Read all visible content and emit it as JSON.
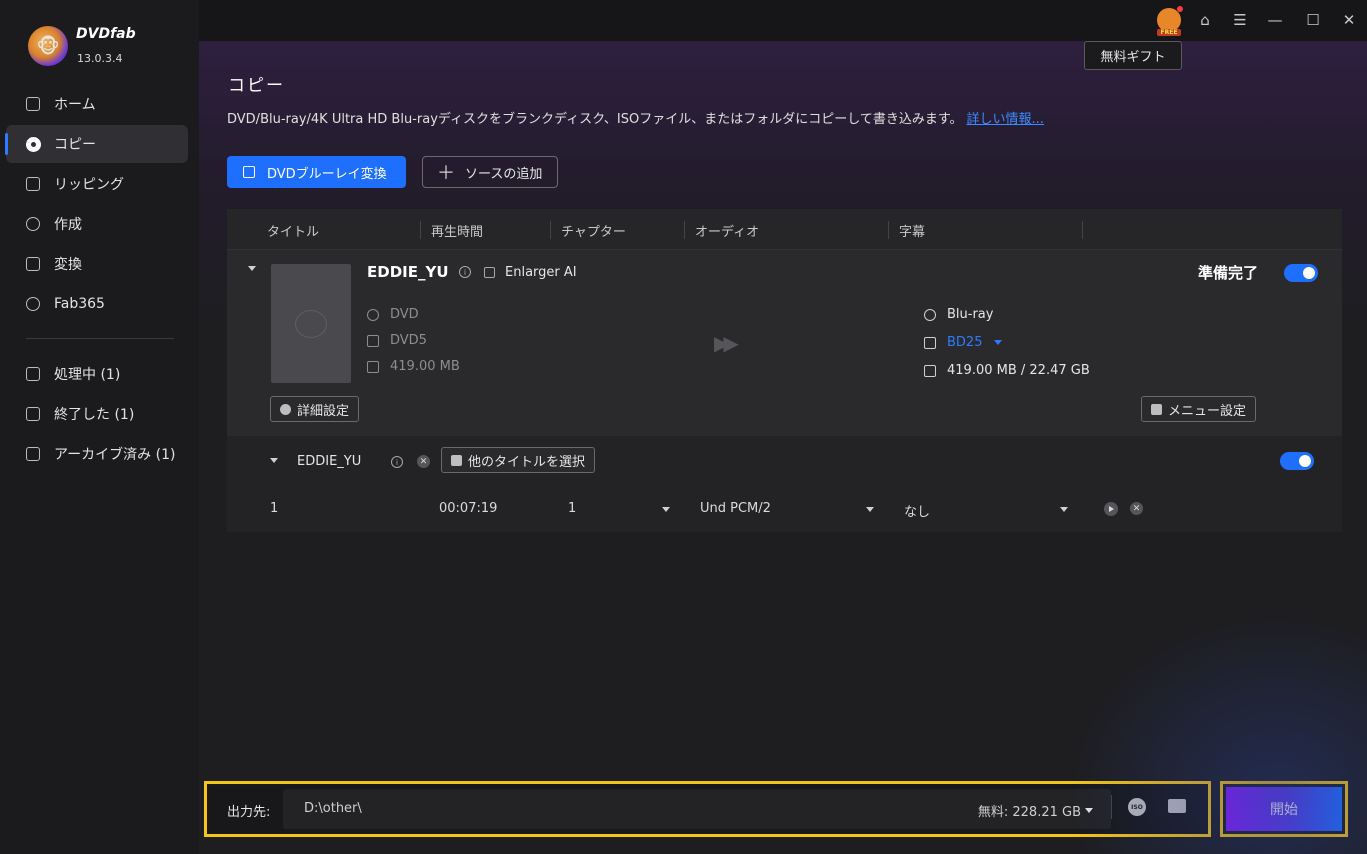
{
  "app": {
    "brand": "DVDfab",
    "version": "13.0.3.4"
  },
  "sidebar": {
    "items": [
      {
        "label": "ホーム",
        "icon": "home-icon"
      },
      {
        "label": "コピー",
        "icon": "disc-icon",
        "active": true
      },
      {
        "label": "リッピング",
        "icon": "ripping-icon"
      },
      {
        "label": "作成",
        "icon": "creator-icon"
      },
      {
        "label": "変換",
        "icon": "converter-icon"
      },
      {
        "label": "Fab365",
        "icon": "fab365-icon"
      }
    ],
    "queue": [
      {
        "label": "処理中 (1)",
        "icon": "processing-icon"
      },
      {
        "label": "終了した (1)",
        "icon": "finished-icon"
      },
      {
        "label": "アーカイブ済み (1)",
        "icon": "archive-icon"
      }
    ]
  },
  "topbar": {
    "tooltip": "無料ギフト",
    "icons": [
      "gift-icon",
      "shirt-icon",
      "menu-icon",
      "minimize-icon",
      "maximize-icon",
      "close-icon"
    ]
  },
  "page": {
    "title": "コピー",
    "description": "DVD/Blu-ray/4K Ultra HD Blu-rayディスクをブランクディスク、ISOファイル、またはフォルダにコピーして書き込みます。",
    "more_link": "詳しい情報...",
    "primary_button": "DVDブルーレイ変換",
    "add_source_button": "ソースの追加"
  },
  "table": {
    "headers": [
      "タイトル",
      "再生時間",
      "チャプター",
      "オーディオ",
      "字幕"
    ],
    "item": {
      "title": "EDDIE_YU",
      "enlarger": "Enlarger AI",
      "status": "準備完了",
      "source": {
        "type": "DVD",
        "format": "DVD5",
        "size": "419.00 MB"
      },
      "target": {
        "type": "Blu-ray",
        "format": "BD25",
        "size": "419.00 MB / 22.47 GB"
      },
      "advanced_button": "詳細設定",
      "menu_button": "メニュー設定"
    },
    "subtitle_row": {
      "title": "EDDIE_YU",
      "select_button": "他のタイトルを選択",
      "row": {
        "index": "1",
        "duration": "00:07:19",
        "chapter": "1",
        "audio": "Und  PCM/2",
        "subtitle": "なし"
      }
    }
  },
  "bottom": {
    "output_label": "出力先:",
    "output_path": "D:\\other\\",
    "free_space": "無料:  228.21 GB",
    "start_button": "開始"
  }
}
